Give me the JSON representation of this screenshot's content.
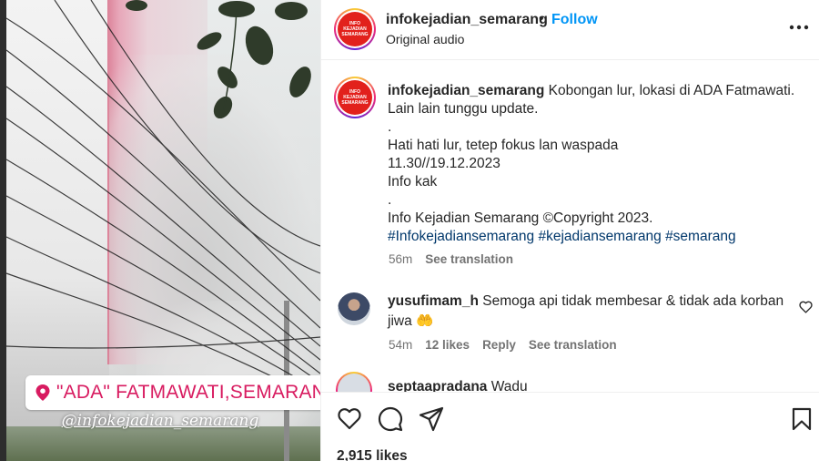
{
  "media": {
    "location_tag": "\"ADA\" FATMAWATI,SEMARANG",
    "watermark": "@infokejadian_semarang"
  },
  "header": {
    "username": "infokejadian_semarang",
    "separator": "•",
    "follow_label": "Follow",
    "audio": "Original audio",
    "avatar_text": "INFO KEJADIAN SEMARANG",
    "more_icon": "more-horizontal-icon"
  },
  "caption": {
    "username": "infokejadian_semarang",
    "line1": "Kobongan lur, lokasi di ADA Fatmawati. Lain lain tunggu update.",
    "dot1": ".",
    "line2": "Hati hati lur, tetep fokus lan waspada",
    "line3": "11.30//19.12.2023",
    "line4": "Info kak",
    "dot2": ".",
    "line5": "Info Kejadian Semarang ©Copyright 2023.",
    "hashtags": [
      "#Infokejadiansemarang",
      "#kejadiansemarang",
      "#semarang"
    ],
    "time": "56m",
    "see_translation": "See translation"
  },
  "comments": [
    {
      "username": "yusufimam_h",
      "text": "Semoga api tidak membesar & tidak ada korban jiwa 🤲",
      "time": "54m",
      "likes": "12 likes",
      "reply": "Reply",
      "see_translation": "See translation"
    },
    {
      "username": "septaapradana",
      "text": "Wadu"
    }
  ],
  "actions": {
    "icons": [
      "heart-icon",
      "comment-icon",
      "share-icon",
      "bookmark-icon"
    ],
    "likes": "2,915 likes"
  },
  "colors": {
    "accent": "#0095f6",
    "hashtag": "#00376b",
    "muted": "#737373",
    "location_text": "#d81b60",
    "logo_red": "#e2211c"
  }
}
